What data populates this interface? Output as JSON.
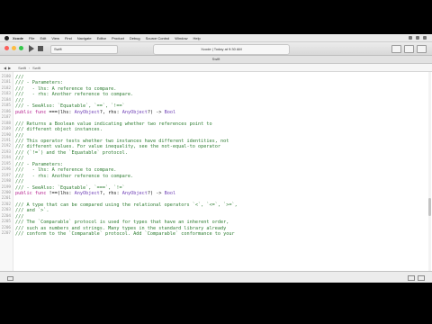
{
  "menubar": {
    "app": "Xcode",
    "items": [
      "File",
      "Edit",
      "View",
      "Find",
      "Navigate",
      "Editor",
      "Product",
      "Debug",
      "Source Control",
      "Window",
      "Help"
    ]
  },
  "toolbar": {
    "scheme": "Swift",
    "activity": "Xcode  |  Today at 9:30 AM"
  },
  "tab_title": "Swift",
  "jumpbar": {
    "crumbs": [
      "Swift",
      "Swift"
    ]
  },
  "editor": {
    "lines": [
      {
        "n": "2180",
        "t": "///",
        "k": "comment"
      },
      {
        "n": "2181",
        "t": "/// - Parameters:",
        "k": "comment"
      },
      {
        "n": "2182",
        "t": "///   - lhs: A reference to compare.",
        "k": "comment"
      },
      {
        "n": "2183",
        "t": "///   - rhs: Another reference to compare.",
        "k": "comment"
      },
      {
        "n": "2184",
        "t": "///",
        "k": "comment"
      },
      {
        "n": "2185",
        "t": "/// - SeeAlso: `Equatable`, `==`, `!==`",
        "k": "comment"
      },
      {
        "n": "2186",
        "t": "public func ===(lhs: AnyObject?, rhs: AnyObject?) -> Bool",
        "k": "code"
      },
      {
        "n": "2187",
        "t": "",
        "k": "plain"
      },
      {
        "n": "2188",
        "t": "/// Returns a Boolean value indicating whether two references point to",
        "k": "comment"
      },
      {
        "n": "2189",
        "t": "/// different object instances.",
        "k": "comment"
      },
      {
        "n": "2190",
        "t": "///",
        "k": "comment"
      },
      {
        "n": "2191",
        "t": "/// This operator tests whether two instances have different identities, not",
        "k": "comment"
      },
      {
        "n": "2192",
        "t": "/// different values. For value inequality, see the not-equal-to operator",
        "k": "comment"
      },
      {
        "n": "2193",
        "t": "/// (`!=`) and the `Equatable` protocol.",
        "k": "comment"
      },
      {
        "n": "2194",
        "t": "///",
        "k": "comment"
      },
      {
        "n": "2195",
        "t": "/// - Parameters:",
        "k": "comment"
      },
      {
        "n": "2196",
        "t": "///   - lhs: A reference to compare.",
        "k": "comment"
      },
      {
        "n": "2197",
        "t": "///   - rhs: Another reference to compare.",
        "k": "comment"
      },
      {
        "n": "2198",
        "t": "///",
        "k": "comment"
      },
      {
        "n": "2199",
        "t": "/// - SeeAlso: `Equatable`, `===`, `!=`",
        "k": "comment"
      },
      {
        "n": "2200",
        "t": "public func !==(lhs: AnyObject?, rhs: AnyObject?) -> Bool",
        "k": "code"
      },
      {
        "n": "2201",
        "t": "",
        "k": "plain"
      },
      {
        "n": "2202",
        "t": "/// A type that can be compared using the relational operators `<`, `<=`, `>=`,",
        "k": "comment"
      },
      {
        "n": "2203",
        "t": "/// and `>`.",
        "k": "comment"
      },
      {
        "n": "2204",
        "t": "///",
        "k": "comment"
      },
      {
        "n": "2205",
        "t": "/// The `Comparable` protocol is used for types that have an inherent order,",
        "k": "comment"
      },
      {
        "n": "2206",
        "t": "/// such as numbers and strings. Many types in the standard library already",
        "k": "comment"
      },
      {
        "n": "2207",
        "t": "/// conform to the `Comparable` protocol. Add `Comparable` conformance to your",
        "k": "comment"
      }
    ]
  },
  "colors": {
    "comment": "#2e7d32",
    "keyword": "#b5218f",
    "type": "#6d3db5"
  }
}
